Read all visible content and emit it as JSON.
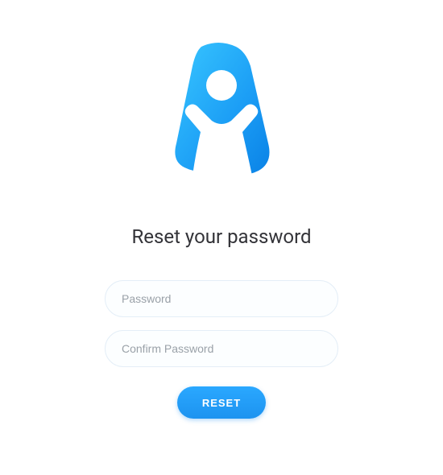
{
  "heading": "Reset your password",
  "form": {
    "password_placeholder": "Password",
    "confirm_password_placeholder": "Confirm Password",
    "submit_label": "RESET"
  },
  "logo": {
    "name": "person-arms-up-icon"
  }
}
